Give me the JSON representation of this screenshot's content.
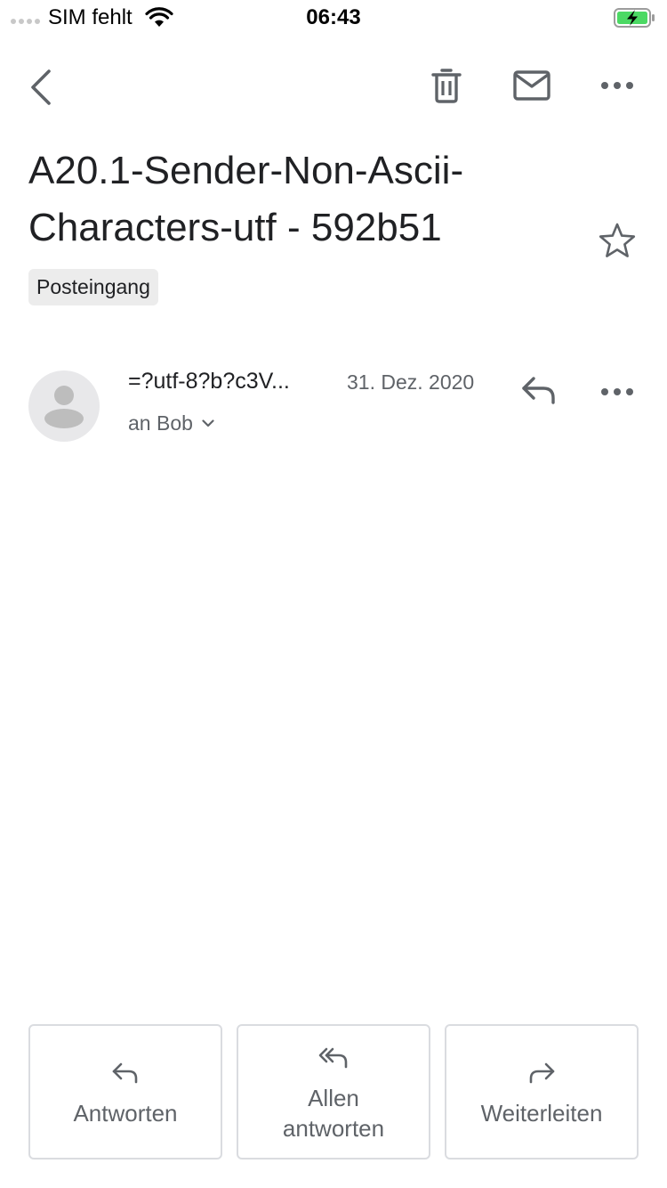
{
  "status_bar": {
    "carrier": "SIM fehlt",
    "time": "06:43",
    "battery_color": "#4cd964"
  },
  "toolbar": {
    "icons": [
      "back-icon",
      "trash-icon",
      "mail-icon",
      "more-icon"
    ]
  },
  "email": {
    "subject": "A20.1-Sender-Non-Ascii-Characters-utf - 592b51",
    "label": "Posteingang",
    "starred": false
  },
  "message": {
    "sender": "=?utf-8?b?c3V...",
    "date": "31. Dez. 2020",
    "recipient": "an Bob"
  },
  "actions": {
    "reply_label": "Antworten",
    "reply_all_label": "Allen antworten",
    "forward_label": "Weiterleiten"
  },
  "colors": {
    "icon_gray": "#5f6368",
    "text": "#202124",
    "border": "#dadce0"
  }
}
